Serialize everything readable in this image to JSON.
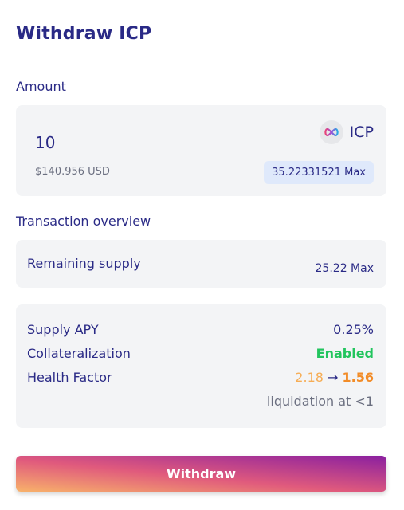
{
  "title": "Withdraw ICP",
  "amount": {
    "label": "Amount",
    "value": "10",
    "token": "ICP",
    "token_icon": "infinity-logo-icon",
    "usd_value": "$140.956 USD",
    "max_text": "35.22331521 Max"
  },
  "overview": {
    "label": "Transaction overview",
    "remaining_supply_label": "Remaining supply",
    "remaining_supply_value": "25.22 Max",
    "supply_apy_label": "Supply APY",
    "supply_apy_value": "0.25%",
    "collateralization_label": "Collateralization",
    "collateralization_value": "Enabled",
    "health_factor_label": "Health Factor",
    "health_factor_old": "2.18",
    "health_factor_arrow": "→",
    "health_factor_new": "1.56",
    "liquidation_note": "liquidation at <1"
  },
  "withdraw_button": "Withdraw",
  "colors": {
    "primary_text": "#2a2a86",
    "enabled": "#22c55e",
    "health_old": "#f6ad55",
    "health_new": "#f28c28",
    "card_bg": "#f3f4f6",
    "max_badge_bg": "#dfe9fb"
  }
}
